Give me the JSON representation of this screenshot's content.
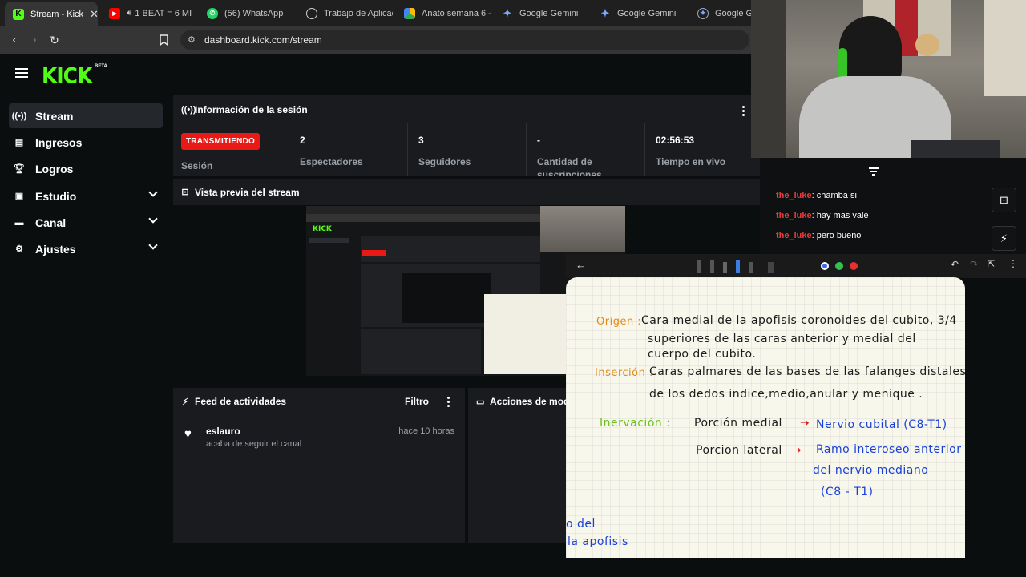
{
  "browser": {
    "tabs": [
      {
        "label": "Stream - Kick",
        "active": true
      },
      {
        "label": "1 BEAT = 6 MI"
      },
      {
        "label": "(56) WhatsApp"
      },
      {
        "label": "Trabajo de Aplicac"
      },
      {
        "label": "Anato semana 6 -"
      },
      {
        "label": "Google Gemini"
      },
      {
        "label": "Google Gemini"
      },
      {
        "label": "Google Ge"
      }
    ],
    "url": "dashboard.kick.com/stream"
  },
  "kick": {
    "logo": "KICK",
    "beta": "BETA"
  },
  "sidebar": {
    "items": [
      {
        "label": "Stream",
        "icon": "broadcast-icon"
      },
      {
        "label": "Ingresos",
        "icon": "bar-chart-icon"
      },
      {
        "label": "Logros",
        "icon": "trophy-icon"
      },
      {
        "label": "Estudio",
        "icon": "studio-icon"
      },
      {
        "label": "Canal",
        "icon": "channel-icon"
      },
      {
        "label": "Ajustes",
        "icon": "gear-icon"
      }
    ]
  },
  "session": {
    "title": "Información de la sesión",
    "badge": "TRANSMITIENDO",
    "badge_color": "#e91916",
    "session_label": "Sesión",
    "stats": [
      {
        "value": "2",
        "label": "Espectadores"
      },
      {
        "value": "3",
        "label": "Seguidores"
      },
      {
        "value": "-",
        "label": "Cantidad de suscripciones"
      },
      {
        "value": "02:56:53",
        "label": "Tiempo en vivo"
      }
    ]
  },
  "preview": {
    "title": "Vista previa del stream"
  },
  "activity": {
    "title": "Feed de actividades",
    "filter": "Filtro",
    "items": [
      {
        "user": "eslauro",
        "desc": "acaba de seguir el canal",
        "time": "hace 10 horas"
      }
    ]
  },
  "mod_actions": {
    "title": "Acciones de mod"
  },
  "chat": {
    "messages": [
      {
        "user": "the_luke",
        "text": "chamba si"
      },
      {
        "user": "the_luke",
        "text": "hay mas vale"
      },
      {
        "user": "the_luke",
        "text": "pero bueno"
      }
    ]
  },
  "notes": {
    "origen_label": "Origen :",
    "origen_lines": [
      "Cara medial de la apofisis coronoides del cubito, 3/4",
      "superiores de las caras anterior y medial del",
      "cuerpo del cubito."
    ],
    "insercion_label": "Inserción :",
    "insercion_lines": [
      "Caras palmares de las bases de las falanges distales",
      "de los dedos indice,medio,anular y menique ."
    ],
    "inervacion_label": "Inervación :",
    "medial_label": "Porción medial",
    "medial_nerve": "Nervio cubital (C8-T1)",
    "lateral_label": "Porcion lateral",
    "lateral_nerve_1": "Ramo interoseo anterior",
    "lateral_nerve_2": "del nervio mediano",
    "lateral_nerve_3": "(C8 - T1)",
    "fragment_1": "o del",
    "fragment_2": "la apofisis"
  },
  "colors": {
    "kick_green": "#53fc18",
    "live_red": "#e91916",
    "chat_user": "#ee3a3a"
  }
}
